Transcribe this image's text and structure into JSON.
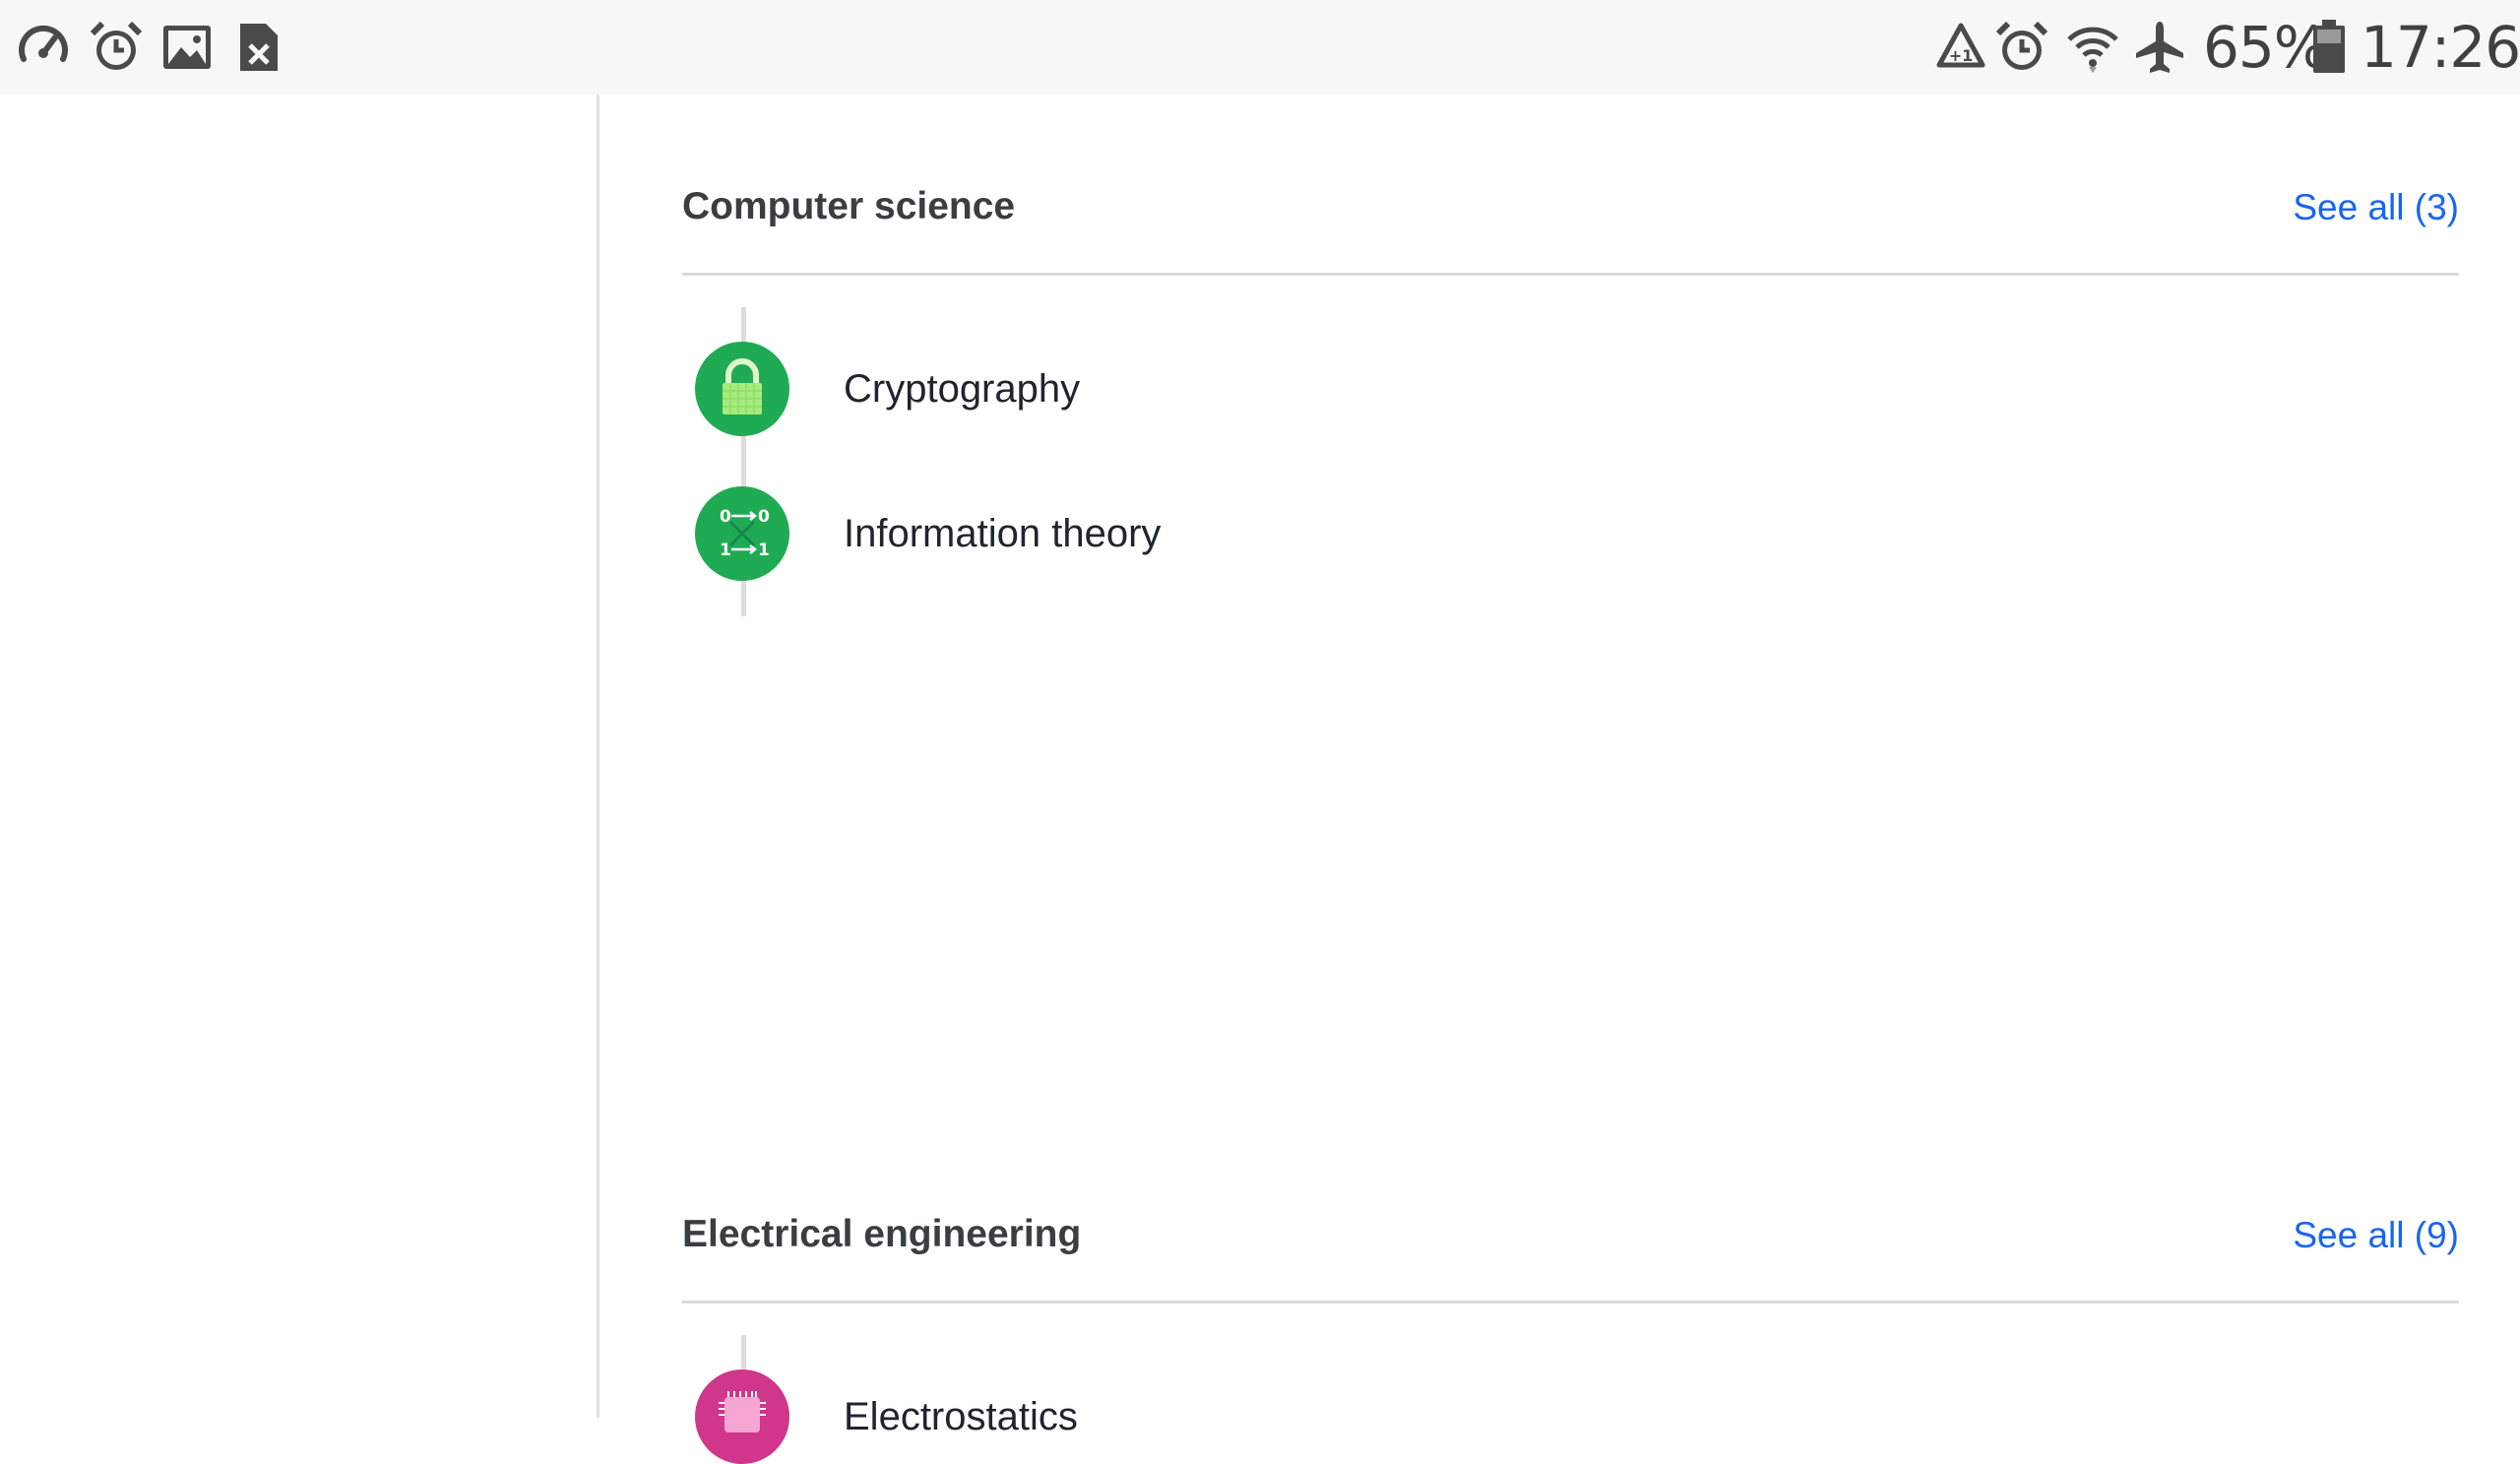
{
  "status_bar": {
    "left_icons": [
      "speedometer-icon",
      "alarm-icon",
      "gallery-icon",
      "sim-error-icon"
    ],
    "right_icons": [
      "recycle-icon",
      "alarm-icon",
      "wifi-icon",
      "airplane-icon",
      "battery-icon"
    ],
    "battery_percent": "65%",
    "time": "17:26"
  },
  "sections": [
    {
      "title": "Computer science",
      "see_all": "See all (3)",
      "topics": [
        {
          "label": "Cryptography",
          "icon": "lock-icon",
          "color": "#1fab54"
        },
        {
          "label": "Information theory",
          "icon": "binary-channel-icon",
          "color": "#1fab54"
        }
      ]
    },
    {
      "title": "Electrical engineering",
      "see_all": "See all (9)",
      "topics": [
        {
          "label": "Electrostatics",
          "icon": "chip-icon",
          "color": "#d0368a"
        }
      ]
    }
  ],
  "colors": {
    "link": "#1865f2",
    "status_bar_bg": "#f7f7f7",
    "computer_science": "#1fab54",
    "electrical_engineering": "#d0368a"
  }
}
